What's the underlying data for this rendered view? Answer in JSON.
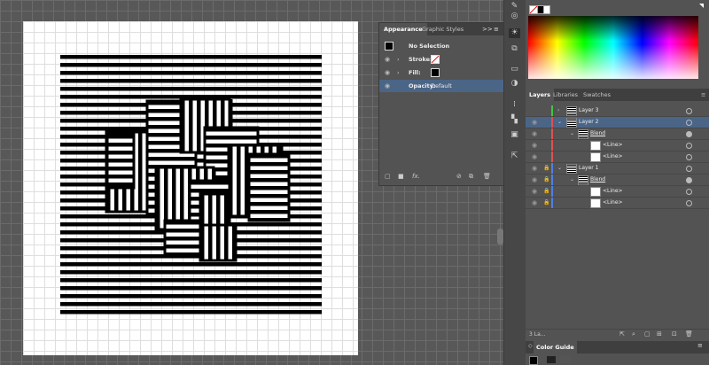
{
  "appearance": {
    "tabs": [
      "Appearance",
      "Graphic Styles"
    ],
    "collapse": ">>",
    "menu": "≡",
    "selection_label": "No Selection",
    "rows": [
      {
        "label": "Stroke:",
        "swatch": "none"
      },
      {
        "label": "Fill:",
        "swatch": "#000000"
      }
    ],
    "opacity_label": "Opacity:",
    "opacity_value": "Default",
    "footer_fx": "fx."
  },
  "layers": {
    "tabs": [
      "Layers",
      "Libraries",
      "Swatches"
    ],
    "rows": [
      {
        "name": "Layer 3",
        "color": "#3cc83c"
      },
      {
        "name": "Layer 2",
        "color": "#e05050"
      },
      {
        "name": "Blend",
        "color": "#e05050"
      },
      {
        "name": "<Line>",
        "color": "#e05050"
      },
      {
        "name": "<Line>",
        "color": "#e05050"
      },
      {
        "name": "Layer 1",
        "color": "#4f7fe0"
      },
      {
        "name": "Blend",
        "color": "#4f7fe0"
      },
      {
        "name": "<Line>",
        "color": "#4f7fe0"
      },
      {
        "name": "<Line>",
        "color": "#4f7fe0"
      }
    ],
    "count_label": "3 La..."
  },
  "color_guide": {
    "tab": "Color Guide",
    "chevron": "◇"
  },
  "colors": {
    "selection_blue": "#4b6587",
    "panel_bg": "#535353",
    "tab_bg": "#3f3f3f"
  },
  "icons": [
    "eye-icon",
    "chevron-right-icon",
    "chevron-down-icon",
    "lock-icon",
    "target-icon",
    "trash-icon",
    "new-layer-icon",
    "menu-icon",
    "fx-icon"
  ]
}
